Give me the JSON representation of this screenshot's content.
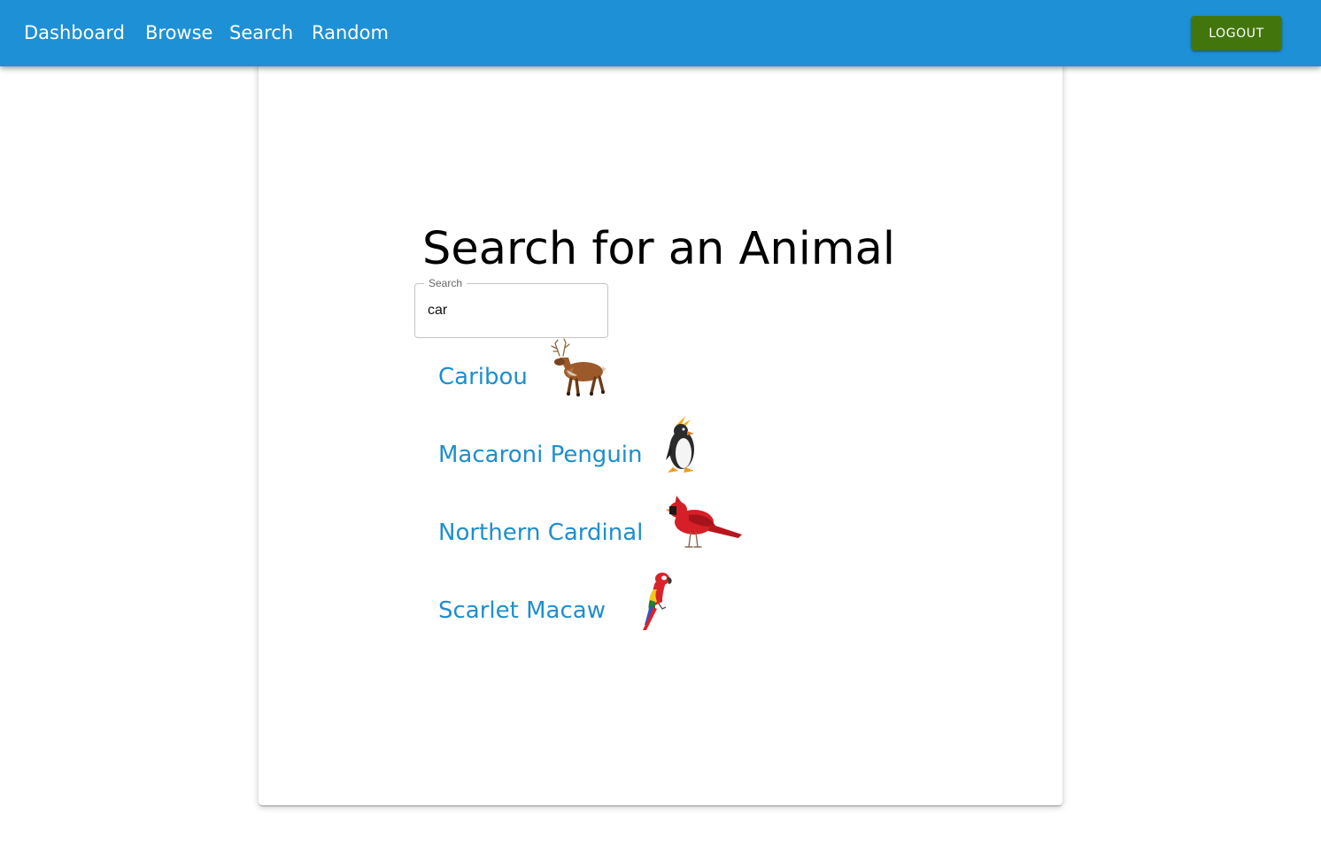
{
  "nav": {
    "links": [
      {
        "label": "Dashboard"
      },
      {
        "label": "Browse"
      },
      {
        "label": "Search"
      },
      {
        "label": "Random"
      }
    ],
    "logout_label": "LOGOUT"
  },
  "page": {
    "title": "Search for an Animal"
  },
  "search": {
    "label": "Search",
    "value": "car"
  },
  "results": [
    {
      "name": "Caribou",
      "icon": "caribou-icon"
    },
    {
      "name": "Macaroni Penguin",
      "icon": "penguin-icon"
    },
    {
      "name": "Northern Cardinal",
      "icon": "cardinal-icon"
    },
    {
      "name": "Scarlet Macaw",
      "icon": "macaw-icon"
    }
  ],
  "colors": {
    "appbar": "#1e91d6",
    "logout_button": "#43750d",
    "result_link": "#1e8ecf"
  }
}
